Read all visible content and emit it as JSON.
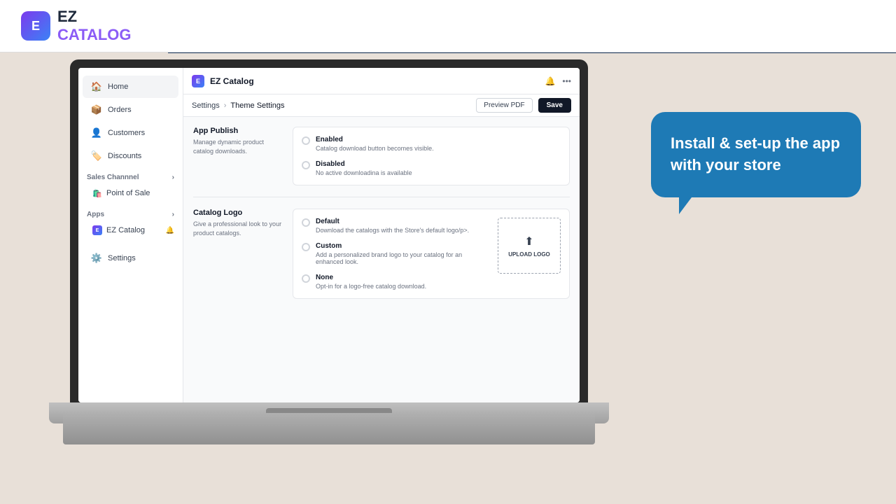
{
  "brand": {
    "name_ez": "EZ",
    "name_catalog": "CATALOG",
    "logo_letter": "E"
  },
  "topbar": {
    "divider_visible": true
  },
  "sidebar": {
    "items": [
      {
        "id": "home",
        "label": "Home",
        "icon": "🏠",
        "active": true
      },
      {
        "id": "orders",
        "label": "Orders",
        "icon": "📦",
        "active": false
      },
      {
        "id": "customers",
        "label": "Customers",
        "icon": "👤",
        "active": false
      },
      {
        "id": "discounts",
        "label": "Discounts",
        "icon": "⚙️",
        "active": false
      }
    ],
    "sales_channel": {
      "label": "Sales Channnel",
      "items": [
        {
          "id": "pos",
          "label": "Point of Sale",
          "icon": "🛍️"
        }
      ]
    },
    "apps": {
      "label": "Apps",
      "items": [
        {
          "id": "ez-catalog",
          "label": "EZ Catalog",
          "has_bell": true
        }
      ]
    },
    "settings": {
      "label": "Settings",
      "icon": "⚙️"
    }
  },
  "app": {
    "title": "EZ Catalog",
    "logo_letter": "E",
    "bell_icon": "🔔",
    "more_icon": "⋯"
  },
  "breadcrumb": {
    "parent": "Settings",
    "separator": "›",
    "current": "Theme Settings"
  },
  "actions": {
    "preview_label": "Preview PDF",
    "save_label": "Save"
  },
  "sections": {
    "app_publish": {
      "title": "App Publish",
      "description": "Manage dynamic product catalog downloads.",
      "options": [
        {
          "id": "enabled",
          "label": "Enabled",
          "description": "Catalog download button becomes visible."
        },
        {
          "id": "disabled",
          "label": "Disabled",
          "description": "No active downloadina is available"
        }
      ]
    },
    "catalog_logo": {
      "title": "Catalog Logo",
      "description": "Give a professional look to your product catalogs.",
      "options": [
        {
          "id": "default",
          "label": "Default",
          "description": "Download the catalogs with the Store's default logo/p>."
        },
        {
          "id": "custom",
          "label": "Custom",
          "description": "Add a personalized brand logo to your catalog for an enhanced look."
        },
        {
          "id": "none",
          "label": "None",
          "description": "Opt-in for a logo-free catalog download."
        }
      ],
      "upload_label": "UPLOAD LOGO",
      "upload_icon": "⬆"
    }
  },
  "speech_bubble": {
    "text": "Install & set-up the app with your store",
    "bg_color": "#1e7ab5"
  }
}
